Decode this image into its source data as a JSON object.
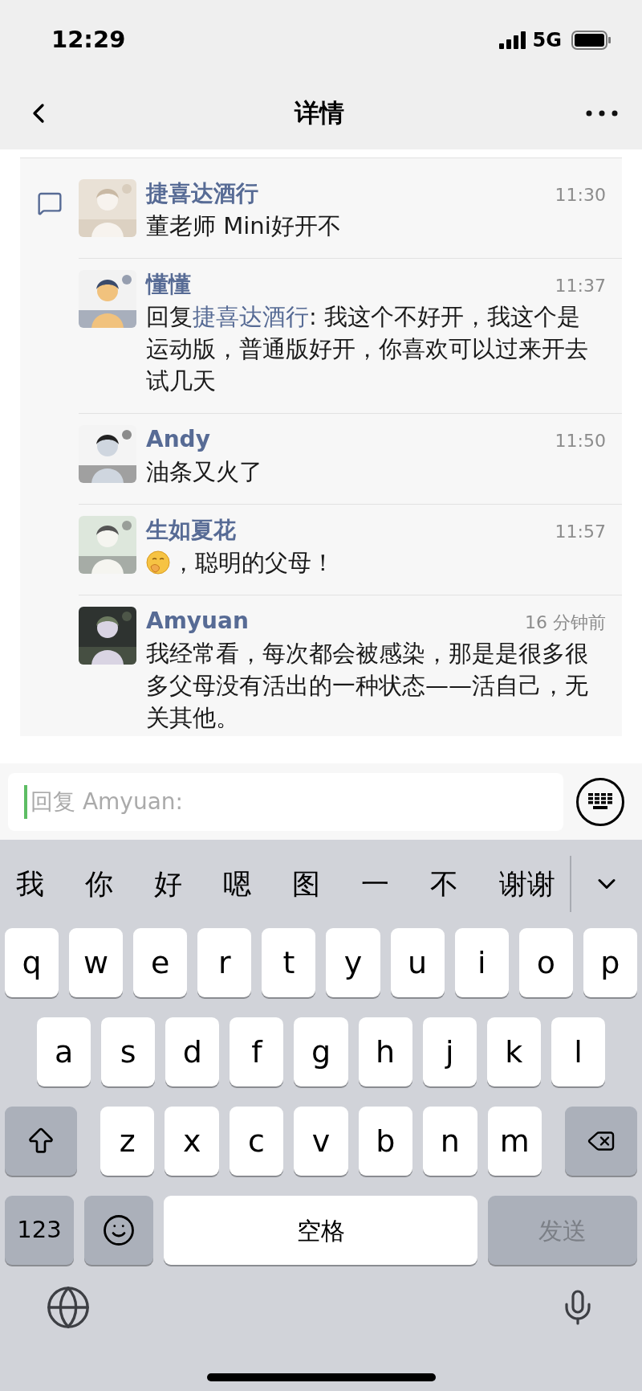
{
  "status_bar": {
    "time": "12:29",
    "network": "5G"
  },
  "nav": {
    "title": "详情"
  },
  "comments": [
    {
      "name": "捷喜达酒行",
      "time": "11:30",
      "has_emoji": false,
      "text": "董老师 Mini好开不"
    },
    {
      "name": "懂懂",
      "time": "11:37",
      "has_emoji": false,
      "reply_prefix": "回复",
      "reply_to": "捷喜达酒行",
      "text": ": 我这个不好开，我这个是运动版，普通版好开，你喜欢可以过来开去试几天"
    },
    {
      "name": "Andy",
      "time": "11:50",
      "has_emoji": false,
      "text": "油条又火了"
    },
    {
      "name": "生如夏花",
      "time": "11:57",
      "has_emoji": true,
      "text": "，聪明的父母！"
    },
    {
      "name": "Amyuan",
      "time": "16 分钟前",
      "has_emoji": false,
      "text": "我经常看，每次都会被感染，那是是很多很多父母没有活出的一种状态——活自己，无关其他。"
    }
  ],
  "reply_field": {
    "placeholder": "回复 Amyuan:"
  },
  "keyboard": {
    "suggestions": [
      "我",
      "你",
      "好",
      "嗯",
      "图",
      "一",
      "不",
      "谢谢"
    ],
    "rows": [
      [
        "q",
        "w",
        "e",
        "r",
        "t",
        "y",
        "u",
        "i",
        "o",
        "p"
      ],
      [
        "a",
        "s",
        "d",
        "f",
        "g",
        "h",
        "j",
        "k",
        "l"
      ],
      [
        "z",
        "x",
        "c",
        "v",
        "b",
        "n",
        "m"
      ]
    ],
    "numbers_key": "123",
    "space_key": "空格",
    "send_key": "发送",
    "send_enabled": false
  }
}
